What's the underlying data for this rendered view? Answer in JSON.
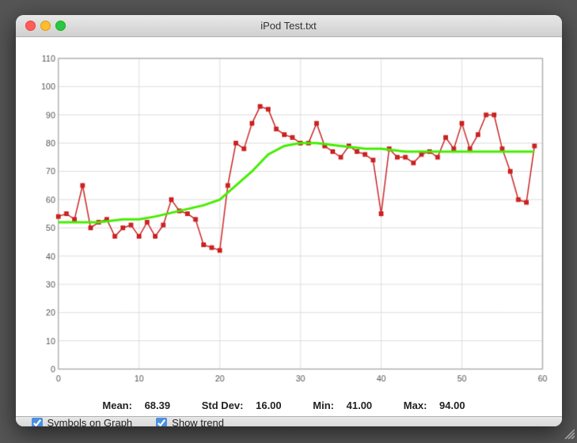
{
  "window": {
    "title": "iPod Test.txt"
  },
  "stats": {
    "mean_label": "Mean:",
    "mean_value": "68.39",
    "stddev_label": "Std Dev:",
    "stddev_value": "16.00",
    "min_label": "Min:",
    "min_value": "41.00",
    "max_label": "Max:",
    "max_value": "94.00"
  },
  "footer": {
    "symbols_label": "Symbols on Graph",
    "trend_label": "Show trend",
    "symbols_checked": true,
    "trend_checked": true
  },
  "chart": {
    "y_max": 110,
    "y_min": 0,
    "y_step": 10,
    "x_max": 60,
    "x_step": 10,
    "data_points": [
      [
        0,
        54
      ],
      [
        1,
        55
      ],
      [
        2,
        53
      ],
      [
        3,
        65
      ],
      [
        4,
        50
      ],
      [
        5,
        52
      ],
      [
        6,
        53
      ],
      [
        7,
        47
      ],
      [
        8,
        50
      ],
      [
        9,
        51
      ],
      [
        10,
        47
      ],
      [
        11,
        52
      ],
      [
        12,
        47
      ],
      [
        13,
        51
      ],
      [
        14,
        60
      ],
      [
        15,
        56
      ],
      [
        16,
        55
      ],
      [
        17,
        53
      ],
      [
        18,
        44
      ],
      [
        19,
        43
      ],
      [
        20,
        42
      ],
      [
        21,
        65
      ],
      [
        22,
        80
      ],
      [
        23,
        78
      ],
      [
        24,
        87
      ],
      [
        25,
        93
      ],
      [
        26,
        92
      ],
      [
        27,
        85
      ],
      [
        28,
        83
      ],
      [
        29,
        82
      ],
      [
        30,
        80
      ],
      [
        31,
        80
      ],
      [
        32,
        87
      ],
      [
        33,
        79
      ],
      [
        34,
        77
      ],
      [
        35,
        75
      ],
      [
        36,
        79
      ],
      [
        37,
        77
      ],
      [
        38,
        76
      ],
      [
        39,
        74
      ],
      [
        40,
        55
      ],
      [
        41,
        78
      ],
      [
        42,
        75
      ],
      [
        43,
        75
      ],
      [
        44,
        73
      ],
      [
        45,
        76
      ],
      [
        46,
        77
      ],
      [
        47,
        75
      ],
      [
        48,
        82
      ],
      [
        49,
        78
      ],
      [
        50,
        87
      ],
      [
        51,
        78
      ],
      [
        52,
        83
      ],
      [
        53,
        90
      ],
      [
        54,
        90
      ],
      [
        55,
        78
      ],
      [
        56,
        70
      ],
      [
        57,
        60
      ],
      [
        58,
        59
      ],
      [
        59,
        79
      ]
    ],
    "trend_points": [
      [
        0,
        52
      ],
      [
        2,
        52
      ],
      [
        5,
        52
      ],
      [
        8,
        53
      ],
      [
        10,
        53
      ],
      [
        12,
        54
      ],
      [
        15,
        56
      ],
      [
        18,
        58
      ],
      [
        20,
        60
      ],
      [
        22,
        65
      ],
      [
        24,
        70
      ],
      [
        26,
        76
      ],
      [
        28,
        79
      ],
      [
        30,
        80
      ],
      [
        32,
        80
      ],
      [
        35,
        79
      ],
      [
        38,
        78
      ],
      [
        40,
        78
      ],
      [
        43,
        77
      ],
      [
        46,
        77
      ],
      [
        49,
        77
      ],
      [
        52,
        77
      ],
      [
        55,
        77
      ],
      [
        58,
        77
      ],
      [
        59,
        77
      ]
    ]
  }
}
